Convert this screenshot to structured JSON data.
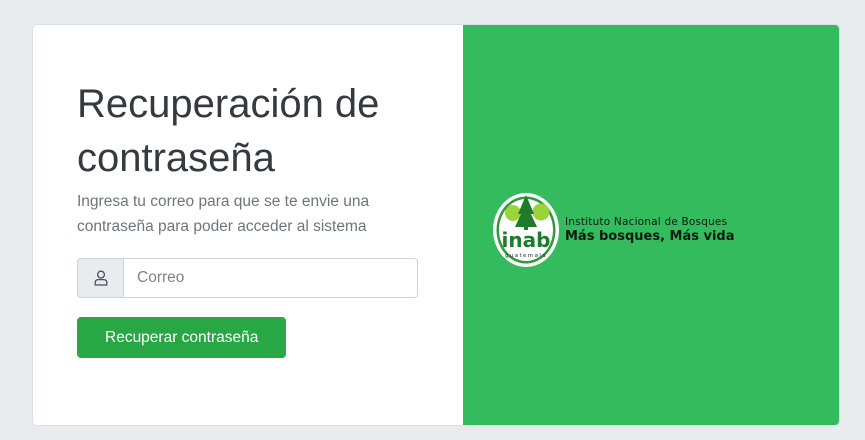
{
  "form": {
    "title": "Recuperación de contraseña",
    "subtitle": "Ingresa tu correo para que se te envie una contraseña para poder acceder al sistema",
    "email_placeholder": "Correo",
    "email_value": "",
    "submit_label": "Recuperar contraseña",
    "input_icon": "user-icon"
  },
  "brand": {
    "logo_word": "inab",
    "logo_sub": "guatemala",
    "org_name": "Instituto Nacional de Bosques",
    "tagline": "Más bosques, Más vida",
    "panel_color": "#33bb5d"
  },
  "colors": {
    "button": "#28a745",
    "background": "#e9ecef"
  }
}
